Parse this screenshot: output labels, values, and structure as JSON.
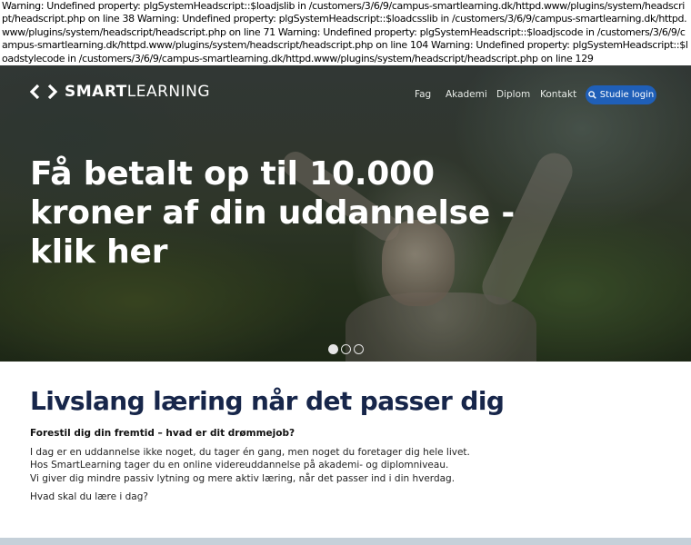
{
  "warnings": "Warning: Undefined property: plgSystemHeadscript::$loadjslib in /customers/3/6/9/campus-smartlearning.dk/httpd.www/plugins/system/headscript/headscript.php on line 38 Warning: Undefined property: plgSystemHeadscript::$loadcsslib in /customers/3/6/9/campus-smartlearning.dk/httpd.www/plugins/system/headscript/headscript.php on line 71 Warning: Undefined property: plgSystemHeadscript::$loadjscode in /customers/3/6/9/campus-smartlearning.dk/httpd.www/plugins/system/headscript/headscript.php on line 104 Warning: Undefined property: plgSystemHeadscript::$loadstylecode in /customers/3/6/9/campus-smartlearning.dk/httpd.www/plugins/system/headscript/headscript.php on line 129",
  "header": {
    "logo_icon": "code-brackets-icon",
    "brand_bold": "SMART",
    "brand_light": "LEARNING",
    "nav": [
      "Fag",
      "Akademi",
      "Diplom",
      "Kontakt"
    ],
    "login_icon": "search-icon",
    "login_label": "Studie login",
    "accent_color": "#1f5fb8"
  },
  "hero": {
    "title": "Få betalt op til 10.000 kroner af din uddannelse - klik her",
    "slides_total": 3,
    "slide_active": 1
  },
  "main": {
    "heading": "Livslang læring når det passer dig",
    "subheading": "Forestil dig din fremtid – hvad er dit drømmejob?",
    "paragraph_lines": [
      "I dag er en uddannelse ikke noget, du tager én gang, men noget du foretager dig hele livet.",
      "Hos SmartLearning tager du en online videreuddannelse på akademi- og diplomniveau.",
      "Vi giver dig mindre passiv lytning og mere aktiv læring, når det passer ind i din hverdag."
    ],
    "question": "Hvad skal du lære i dag?",
    "heading_color": "#17264a"
  }
}
